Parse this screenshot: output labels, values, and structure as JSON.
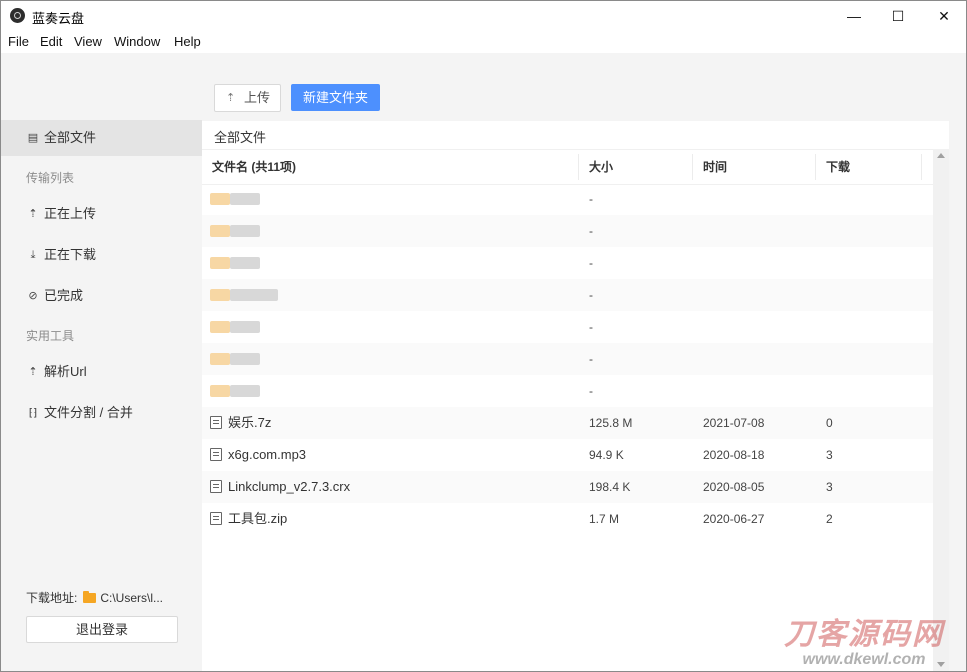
{
  "window": {
    "title": "蓝奏云盘",
    "controls": {
      "minimize": "—",
      "maximize": "☐",
      "close": "✕"
    }
  },
  "menu": [
    "File",
    "Edit",
    "View",
    "Window",
    "Help"
  ],
  "sidebar": {
    "items": [
      {
        "label": "全部文件",
        "icon": "file-list-icon",
        "glyph": "▤",
        "active": true
      },
      {
        "label": "正在上传",
        "icon": "cloud-upload-icon",
        "glyph": "⇡"
      },
      {
        "label": "正在下载",
        "icon": "download-icon",
        "glyph": "⤓"
      },
      {
        "label": "已完成",
        "icon": "check-circle-icon",
        "glyph": "⊘"
      },
      {
        "label": "解析Url",
        "icon": "cloud-icon",
        "glyph": "⇡"
      },
      {
        "label": "文件分割 / 合并",
        "icon": "split-icon",
        "glyph": "⁅⁆"
      }
    ],
    "sections": {
      "transfer": "传输列表",
      "tools": "实用工具"
    },
    "download_path_label": "下载地址:",
    "download_path_value": "C:\\Users\\l...",
    "logout_label": "退出登录"
  },
  "toolbar": {
    "upload_label": "上传",
    "upload_icon": "cloud-upload-icon",
    "new_folder_label": "新建文件夹"
  },
  "breadcrumb": "全部文件",
  "table": {
    "headers": {
      "name": "文件名 (共11项)",
      "size": "大小",
      "time": "时间",
      "downloads": "下载"
    },
    "rows": [
      {
        "type": "folder",
        "name": "",
        "size": "-",
        "time": "",
        "downloads": ""
      },
      {
        "type": "folder",
        "name": "",
        "size": "-",
        "time": "",
        "downloads": ""
      },
      {
        "type": "folder",
        "name": "",
        "size": "-",
        "time": "",
        "downloads": ""
      },
      {
        "type": "folder",
        "name": "",
        "size": "-",
        "time": "",
        "downloads": ""
      },
      {
        "type": "folder",
        "name": "",
        "size": "-",
        "time": "",
        "downloads": ""
      },
      {
        "type": "folder",
        "name": "",
        "size": "-",
        "time": "",
        "downloads": ""
      },
      {
        "type": "folder",
        "name": "",
        "size": "-",
        "time": "",
        "downloads": ""
      },
      {
        "type": "file",
        "name": "娱乐.7z",
        "size": "125.8 M",
        "time": "2021-07-08",
        "downloads": "0"
      },
      {
        "type": "file",
        "name": "x6g.com.mp3",
        "size": "94.9 K",
        "time": "2020-08-18",
        "downloads": "3"
      },
      {
        "type": "file",
        "name": "Linkclump_v2.7.3.crx",
        "size": "198.4 K",
        "time": "2020-08-05",
        "downloads": "3"
      },
      {
        "type": "file",
        "name": "工具包.zip",
        "size": "1.7 M",
        "time": "2020-06-27",
        "downloads": "2"
      }
    ]
  },
  "watermark": {
    "title": "刀客源码网",
    "url": "www.dkewl.com"
  },
  "colors": {
    "accent": "#4d90fe",
    "sidebar_bg": "#f4f4f4",
    "folder": "#f5a623"
  }
}
